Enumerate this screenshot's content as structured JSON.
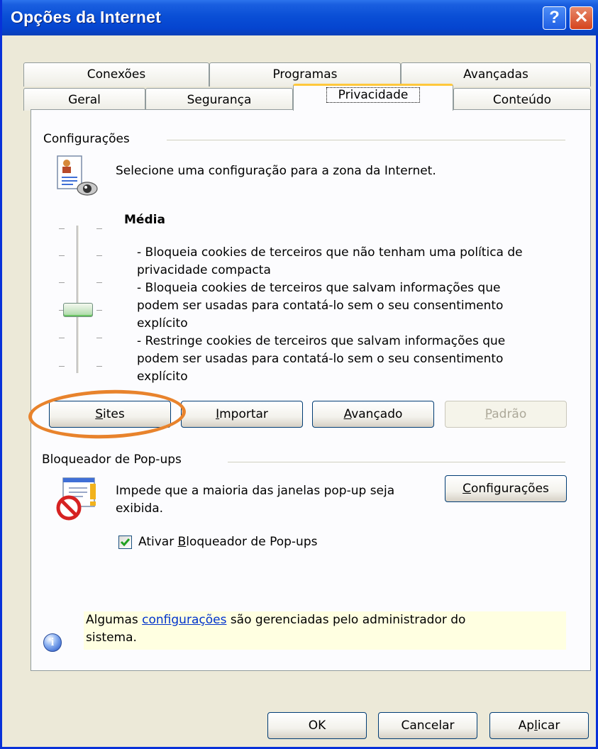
{
  "window": {
    "title": "Opções da Internet"
  },
  "titlebar": {
    "help_label": "?",
    "close_label": "✕"
  },
  "tabs_row1": [
    {
      "label": "Conexões"
    },
    {
      "label": "Programas"
    },
    {
      "label": "Avançadas"
    }
  ],
  "tabs_row2": [
    {
      "label": "Geral"
    },
    {
      "label": "Segurança"
    },
    {
      "label": "Privacidade",
      "active": true
    },
    {
      "label": "Conteúdo"
    }
  ],
  "settings": {
    "title": "Configurações",
    "description": "Selecione uma configuração para a zona da Internet.",
    "level_title": "Média",
    "level_text": [
      "- Bloqueia cookies de terceiros que não tenham uma política de",
      "privacidade compacta",
      "- Bloqueia cookies de terceiros que salvam informações que",
      "podem ser usadas para contatá-lo sem o seu consentimento",
      "explícito",
      "- Restringe cookies de terceiros que salvam informações que",
      "podem ser usadas para contatá-lo sem o seu consentimento",
      "explícito"
    ],
    "slider": {
      "level": "Média",
      "position_of_6": 3
    },
    "buttons": {
      "sites": {
        "pre": "",
        "key": "S",
        "post": "ites"
      },
      "import": {
        "pre": "",
        "key": "I",
        "post": "mportar"
      },
      "advanced": {
        "pre": "",
        "key": "A",
        "post": "vançado"
      },
      "default": {
        "pre": "",
        "key": "P",
        "post": "adrão",
        "disabled": true
      }
    }
  },
  "popup": {
    "title": "Bloqueador de Pop-ups",
    "description_line1": "Impede que a maioria das janelas pop-up seja",
    "description_line2": "exibida.",
    "settings_button": {
      "pre": "",
      "key": "C",
      "post": "onfigurações"
    },
    "checkbox": {
      "pre": "Ativar ",
      "key": "B",
      "post": "loqueador de Pop-ups",
      "checked": true
    }
  },
  "info": {
    "text_pre": "Algumas ",
    "link": "configurações",
    "text_post": " são gerenciadas pelo administrador do",
    "line2": "sistema."
  },
  "footer": {
    "ok": "OK",
    "cancel": "Cancelar",
    "apply": {
      "pre": "Ap",
      "key": "l",
      "post": "icar"
    }
  },
  "colors": {
    "title_bar": "#0a4fd6",
    "dialog_bg": "#ece9d8",
    "panel_bg": "#fcfcfe",
    "highlight_ring": "#e8832c",
    "info_bg": "#ffffe1"
  }
}
